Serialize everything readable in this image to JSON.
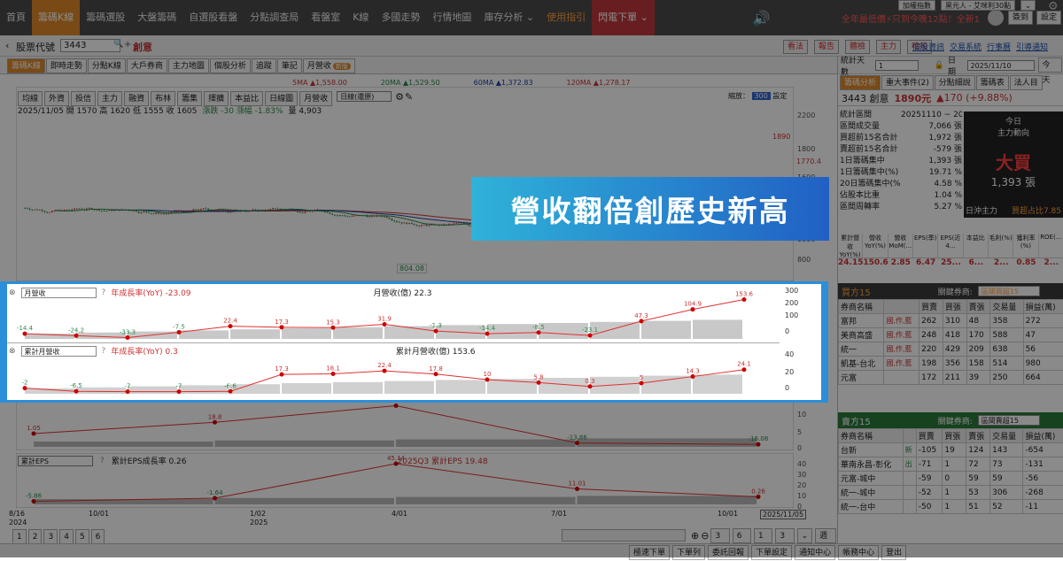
{
  "nav": {
    "items": [
      "首頁",
      "籌碼K線",
      "籌碼選股",
      "大盤籌碼",
      "自選股看盤",
      "分點調查局",
      "看盤室",
      "K線",
      "多國走勢",
      "行情地圖",
      "庫存分析 ⌄",
      "使用指引",
      "閃電下單 ⌄"
    ],
    "promo": "全年最低價⚡只到今晚12點！全新1",
    "user_tags": [
      "加權指數",
      "黑元人 - 艾咪利30點",
      "⌄"
    ],
    "right_btns": [
      "簽到",
      "設定"
    ]
  },
  "stockbar": {
    "label": "股票代號",
    "code": "3443",
    "name": "創意",
    "actions": [
      "看法",
      "報告",
      "體檢",
      "主力",
      "哈拉"
    ],
    "links": [
      "個股資訊",
      "交易系統",
      "行事曆",
      "引導通知"
    ]
  },
  "tabs": [
    "籌碼K線",
    "即時走勢",
    "分點K線",
    "大戶券商",
    "主力地圖",
    "個股分析",
    "追蹤",
    "筆記",
    "月營收"
  ],
  "tab_badge": "新版",
  "toolbar": {
    "tools": [
      "均線",
      "外資",
      "投信",
      "主力",
      "融資",
      "布林",
      "籌集",
      "擇擴",
      "本益比",
      "日線圖",
      "月營收"
    ],
    "period": "日線(還原)",
    "zoom_label": "縮放：",
    "zoom_val": "300",
    "gear": "設定"
  },
  "ma": {
    "ma5": "5MA ▲1,558.00",
    "ma20": "20MA ▲1,529.50",
    "ma60": "60MA ▲1,372.83",
    "ma120": "120MA ▲1,278.17"
  },
  "ohlc": {
    "text": "2025/11/05 開 1570 高 1620 低 1555 收 1605",
    "chg": "漲跌 -30 漲幅 -1.83%",
    "vol": "量 4,903"
  },
  "price_axis": [
    "2200",
    "1800",
    "1600",
    "1000",
    "800"
  ],
  "price_tags": {
    "high": "1890",
    "cur": "1770.4",
    "low": "804.08"
  },
  "rev": {
    "sel1": "月營收",
    "legend1": "年成長率(YoY) -23.09",
    "legend1b": "月營收(億) 22.3",
    "axis1": [
      "300",
      "200",
      "100",
      "0"
    ],
    "sel2": "累計月營收",
    "legend2": "年成長率(YoY) 0.3",
    "legend2b": "累計月營收(億) 153.6",
    "axis2": [
      "40",
      "20",
      "0"
    ]
  },
  "chart_data": [
    {
      "type": "line",
      "title": "月營收 年成長率(YoY)",
      "values": [
        -14.4,
        -24.2,
        -33.3,
        -7.5,
        22.4,
        17.3,
        15.3,
        31.9,
        -1.3,
        -14.4,
        -8.5,
        -23.1,
        47.3,
        104.9,
        153.6
      ],
      "ylim": [
        -40,
        160
      ]
    },
    {
      "type": "line",
      "title": "累計月營收 年成長率(YoY)",
      "values": [
        -2,
        -6.5,
        -7,
        -7,
        -6.6,
        17.3,
        18.1,
        22.4,
        17.8,
        10,
        5.8,
        0.3,
        5,
        14.3,
        24.1
      ],
      "ylim": [
        -10,
        40
      ]
    },
    {
      "type": "line",
      "title": "EPS 年成長率",
      "values": [
        1.05,
        18.8,
        45.14,
        -13.86,
        -16.08
      ],
      "ylim": [
        -20,
        50
      ]
    },
    {
      "type": "line",
      "title": "累計EPS成長率",
      "values": [
        -5.86,
        -1.64,
        45.14,
        11.01,
        0.26
      ],
      "ylim": [
        -10,
        50
      ]
    }
  ],
  "eps": {
    "axis3": [
      "10",
      "5",
      "0"
    ],
    "sel3": "累計EPS",
    "legend3": "累計EPS成長率 0.26",
    "legend3b": "2025Q3 累計EPS 19.48",
    "axis4": [
      "40",
      "30",
      "20",
      "10",
      "0"
    ]
  },
  "xaxis": {
    "labels": [
      "8/16",
      "10/01",
      "1/02",
      "4/01",
      "7/01",
      "10/01"
    ],
    "years": [
      "2024",
      "2025"
    ],
    "cur": "2025/11/05"
  },
  "pages": [
    "1",
    "2",
    "3",
    "4",
    "5",
    "6"
  ],
  "range_btns": [
    "3月",
    "6月",
    "1年",
    "3年",
    "⌄",
    "週價"
  ],
  "banner": "營收翻倍創歷史新高",
  "right": {
    "stat_label": "統計天數",
    "stat_val": "1",
    "date_label": "日期",
    "date_val": "2025/11/10",
    "today": "今天",
    "tabs": [
      "籌碼分析",
      "重大事件(2)",
      "分點細說",
      "籌碼表",
      "法人目"
    ],
    "quote": "3443 創意",
    "price": "1890元",
    "change": "▲170 (+9.88%)",
    "stats": [
      [
        "統計區間",
        "20251110 ~ 202511"
      ],
      [
        "區間成交量",
        "7,066 張"
      ],
      [
        "買超前15名合計",
        "1,972 張"
      ],
      [
        "賣超前15名合計",
        "-579 張"
      ],
      [
        "1日籌碼集中",
        "1,393 張"
      ],
      [
        "1日籌碼集中(%)",
        "19.71 %"
      ],
      [
        "20日籌碼集中(%)",
        "4.58 %"
      ],
      [
        "佔股本比重",
        "1.04 %"
      ],
      [
        "區間周轉率",
        "5.27 %"
      ]
    ],
    "today_label": "今日",
    "mainforce": "主力動向",
    "big": "大買",
    "big_amt": "1,393 張",
    "daytrade": "日沖主力",
    "daytrade_v": "買超占比7.85",
    "kpi_heads": [
      "累計營收YoY(%)",
      "營收YoY(%)",
      "營收MoM(...",
      "EPS(季)",
      "EPS(近4...",
      "本益比",
      "毛利(%)",
      "獲利率(%)",
      "ROE(..."
    ],
    "kpi_vals": [
      "24.15",
      "150.6",
      "2.85",
      "6.47",
      "25...",
      "6...",
      "2...",
      "0.85",
      "2..."
    ],
    "buy_title": "買方15",
    "buy_sel_label": "關鍵券商:",
    "buy_sel": "區間買超15",
    "buy_heads": [
      "券商名稱",
      "",
      "買賣",
      "買張",
      "賣張",
      "交易量",
      "損益(萬)"
    ],
    "buy_rows": [
      [
        "富邦",
        "國,作,藍",
        "262",
        "310",
        "48",
        "358",
        "272"
      ],
      [
        "美商高盛",
        "國,作,藍",
        "248",
        "418",
        "170",
        "588",
        "47"
      ],
      [
        "統一",
        "國,作,藍",
        "220",
        "429",
        "209",
        "638",
        "56"
      ],
      [
        "凱基-台北",
        "國,作,藍",
        "198",
        "356",
        "158",
        "514",
        "980"
      ],
      [
        "元富",
        "",
        "172",
        "211",
        "39",
        "250",
        "664"
      ]
    ],
    "buy_tags": [
      "隔日沖主力",
      "隔日沖主力"
    ],
    "sell_title": "賣方15",
    "sell_sel_label": "關鍵券商:",
    "sell_sel": "區間賣超15",
    "sell_heads": [
      "券商名稱",
      "",
      "買賣",
      "買張",
      "賣張",
      "交易量",
      "損益(萬)"
    ],
    "sell_rows": [
      [
        "台新",
        "新",
        "-105",
        "19",
        "124",
        "143",
        "-654"
      ],
      [
        "華南永昌-彰化",
        "出",
        "-71",
        "1",
        "72",
        "73",
        "-131"
      ],
      [
        "元富-城中",
        "",
        "-59",
        "0",
        "59",
        "59",
        "-56"
      ],
      [
        "統一-城中",
        "",
        "-52",
        "1",
        "53",
        "306",
        "-268"
      ],
      [
        "統一-台中",
        "",
        "-50",
        "1",
        "51",
        "52",
        "-11"
      ]
    ]
  },
  "bottom": [
    "極速下單",
    "下單列",
    "委託回報",
    "下單設定",
    "通知中心",
    "帳務中心",
    "登出"
  ]
}
